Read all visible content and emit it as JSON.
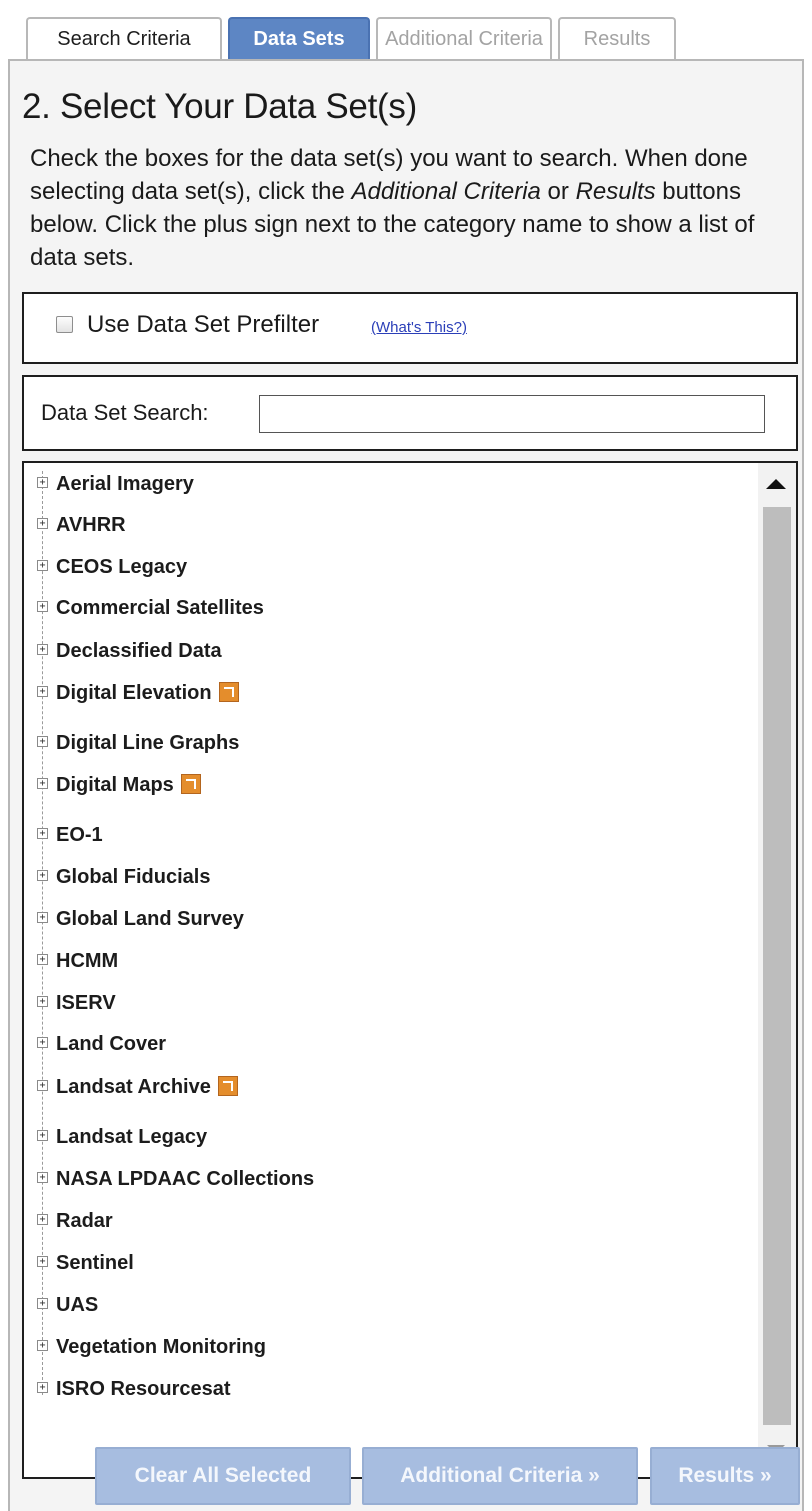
{
  "tabs": [
    {
      "label": "Search Criteria"
    },
    {
      "label": "Data Sets"
    },
    {
      "label": "Additional Criteria"
    },
    {
      "label": "Results"
    }
  ],
  "page_title": "2. Select Your Data Set(s)",
  "instructions": {
    "part1": "Check the boxes for the data set(s) you want to search. When done selecting data set(s), click the ",
    "additional_criteria": "Additional Criteria",
    "part2": " or ",
    "results": "Results",
    "part3": " buttons below. Click the plus sign next to the category name to show a list of data sets."
  },
  "prefilter": {
    "label": "Use Data Set Prefilter",
    "whats_this": "(What's This?)",
    "checked": false
  },
  "search": {
    "label": "Data Set Search:",
    "value": "",
    "placeholder": ""
  },
  "tree": {
    "expander_symbol": "+",
    "items": [
      {
        "label": "Aerial Imagery",
        "badge": false
      },
      {
        "label": "AVHRR",
        "badge": false
      },
      {
        "label": "CEOS Legacy",
        "badge": false
      },
      {
        "label": "Commercial Satellites",
        "badge": false
      },
      {
        "label": "Declassified Data",
        "badge": false
      },
      {
        "label": "Digital Elevation",
        "badge": true
      },
      {
        "label": "Digital Line Graphs",
        "badge": false
      },
      {
        "label": "Digital Maps",
        "badge": true
      },
      {
        "label": "EO-1",
        "badge": false
      },
      {
        "label": "Global Fiducials",
        "badge": false
      },
      {
        "label": "Global Land Survey",
        "badge": false
      },
      {
        "label": "HCMM",
        "badge": false
      },
      {
        "label": "ISERV",
        "badge": false
      },
      {
        "label": "Land Cover",
        "badge": false
      },
      {
        "label": "Landsat Archive",
        "badge": true
      },
      {
        "label": "Landsat Legacy",
        "badge": false
      },
      {
        "label": "NASA LPDAAC Collections",
        "badge": false
      },
      {
        "label": "Radar",
        "badge": false
      },
      {
        "label": "Sentinel",
        "badge": false
      },
      {
        "label": "UAS",
        "badge": false
      },
      {
        "label": "Vegetation Monitoring",
        "badge": false
      },
      {
        "label": "ISRO Resourcesat",
        "badge": false
      }
    ]
  },
  "buttons": {
    "clear_all": "Clear All Selected",
    "additional_criteria": "Additional Criteria »",
    "results": "Results »"
  },
  "colors": {
    "active_tab": "#5d86c4",
    "button_disabled": "#a7bde0",
    "badge": "#e48d2c",
    "link": "#2b3fb8"
  },
  "icons": {
    "expander": "plus-box-icon",
    "badge": "external-link-icon",
    "scroll_up": "arrow-up-icon",
    "scroll_down": "arrow-down-icon"
  }
}
